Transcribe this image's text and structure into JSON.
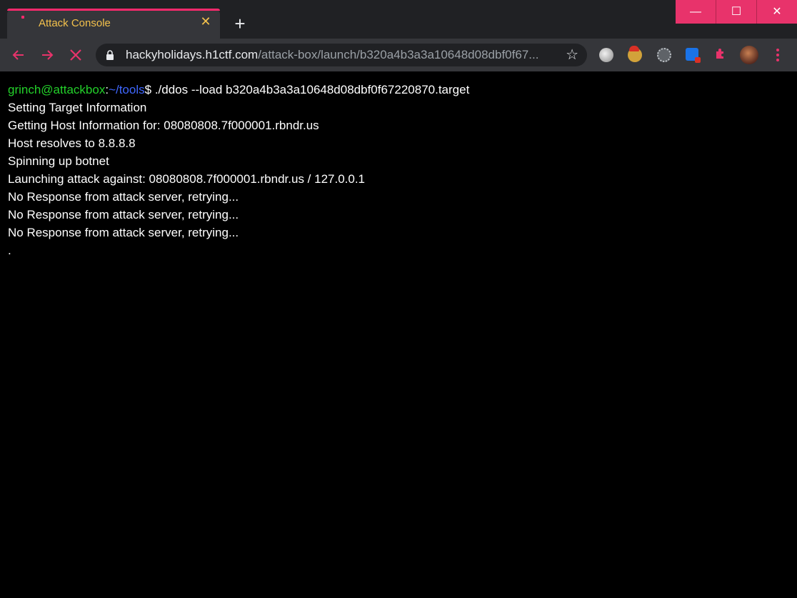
{
  "browser": {
    "tab": {
      "title": "Attack Console",
      "close_glyph": "✕"
    },
    "new_tab_glyph": "+",
    "window_controls": {
      "minimize": "—",
      "maximize": "☐",
      "close": "✕"
    },
    "url": {
      "host": "hackyholidays.h1ctf.com",
      "path": "/attack-box/launch/b320a4b3a3a10648d08dbf0f67..."
    },
    "icons": {
      "back": "arrow-left-icon",
      "forward": "arrow-right-icon",
      "stop": "close-icon",
      "lock": "lock-icon",
      "bookmark": "star-icon",
      "extensions": "puzzle-icon",
      "menu": "more-vert-icon"
    },
    "colors": {
      "accent": "#e8336b",
      "tab_title": "#f3c14c"
    }
  },
  "terminal": {
    "prompt": {
      "user_host": "grinch@attackbox",
      "separator": ":",
      "dir": "~/tools",
      "symbol": "$ "
    },
    "command": "./ddos --load b320a4b3a3a10648d08dbf0f67220870.target",
    "output": [
      "Setting Target Information",
      "Getting Host Information for: 08080808.7f000001.rbndr.us",
      "Host resolves to 8.8.8.8",
      "Spinning up botnet",
      "Launching attack against: 08080808.7f000001.rbndr.us / 127.0.0.1",
      "No Response from attack server, retrying...",
      "No Response from attack server, retrying...",
      "No Response from attack server, retrying...",
      "."
    ],
    "colors": {
      "user_host": "#23d12a",
      "dir": "#3f67ff",
      "text": "#ffffff",
      "background": "#000000"
    }
  }
}
